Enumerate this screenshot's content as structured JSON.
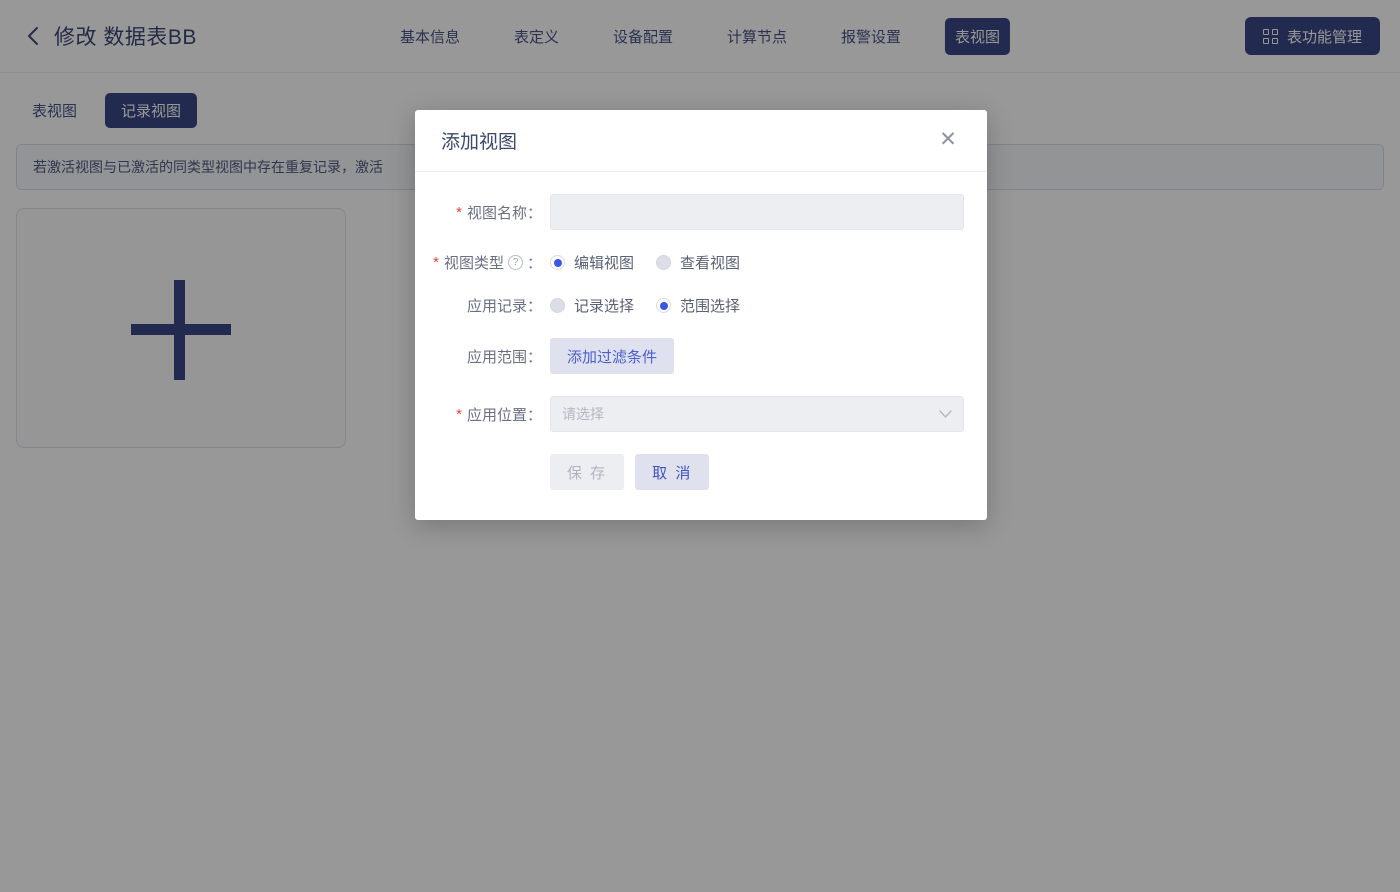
{
  "header": {
    "back_icon": "chevron-left-icon",
    "title": "修改 数据表BB",
    "nav": [
      {
        "label": "基本信息",
        "active": false
      },
      {
        "label": "表定义",
        "active": false
      },
      {
        "label": "设备配置",
        "active": false
      },
      {
        "label": "计算节点",
        "active": false
      },
      {
        "label": "报警设置",
        "active": false
      },
      {
        "label": "表视图",
        "active": true
      }
    ],
    "func_button": {
      "label": "表功能管理",
      "icon": "grid-icon"
    }
  },
  "subtabs": [
    {
      "label": "表视图",
      "active": false
    },
    {
      "label": "记录视图",
      "active": true
    }
  ],
  "notice": "若激活视图与已激活的同类型视图中存在重复记录，激活",
  "add_card": {
    "icon": "plus-icon"
  },
  "modal": {
    "title": "添加视图",
    "close_icon": "close-icon",
    "fields": {
      "view_name": {
        "label": "视图名称：",
        "required": true,
        "value": "",
        "placeholder": ""
      },
      "view_type": {
        "label": "视图类型",
        "suffix": "：",
        "required": true,
        "help_icon": "question-circle-icon",
        "options": [
          {
            "label": "编辑视图",
            "selected": true
          },
          {
            "label": "查看视图",
            "selected": false
          }
        ]
      },
      "apply_record": {
        "label": "应用记录：",
        "required": false,
        "options": [
          {
            "label": "记录选择",
            "selected": false
          },
          {
            "label": "范围选择",
            "selected": true
          }
        ]
      },
      "apply_scope": {
        "label": "应用范围：",
        "required": false,
        "button_label": "添加过滤条件"
      },
      "apply_position": {
        "label": "应用位置：",
        "required": true,
        "placeholder": "请选择",
        "chevron_icon": "chevron-down-icon"
      }
    },
    "actions": {
      "save_label": "保 存",
      "save_disabled": true,
      "cancel_label": "取 消"
    }
  },
  "colors": {
    "brand_dark": "#2e3d7d",
    "accent_blue": "#3a56e4",
    "required_red": "#e8413c",
    "ghost_bg": "#dfe2ee",
    "input_bg": "#eceef2"
  }
}
